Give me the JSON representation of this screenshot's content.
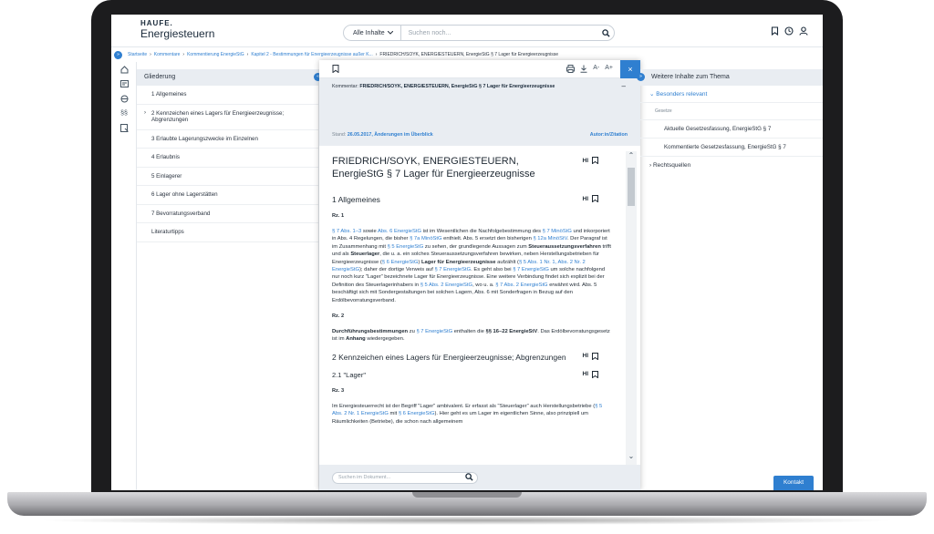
{
  "header": {
    "brand": "HAUFE.",
    "product": "Energiesteuern",
    "search_scope": "Alle Inhalte",
    "search_placeholder": "Suchen noch..."
  },
  "breadcrumb": [
    "Startseite",
    "Kommentare",
    "Kommentierung EnergieStG",
    "Kapitel 2 - Bestimmungen für Energieerzeugnisse außer K...",
    "FRIEDRICH/SOYK, ENERGIESTEUERN, EnergieStG § 7 Lager für Energieerzeugnisse"
  ],
  "outline": {
    "title": "Gliederung",
    "items": [
      "1 Allgemeines",
      "2 Kennzeichen eines Lagers für Energieerzeugnisse; Abgrenzungen",
      "3 Erlaubte Lagerungszwecke im Einzelnen",
      "4 Erlaubnis",
      "5 Einlagerer",
      "6 Lager ohne Lagerstätten",
      "7 Bevorratungsverband",
      "Literaturtipps"
    ]
  },
  "doc": {
    "toolbar": {
      "font_small": "A-",
      "font_large": "A+",
      "close": "×"
    },
    "meta_label": "Kommentar:",
    "meta_value": "FRIEDRICH/SOYK, ENERGIESTEUERN, EnergieStG § 7 Lager für Energieerzeugnisse",
    "meta_minus": "–",
    "stand_label": "Stand:",
    "stand_value": "26.05.2017, Änderungen im Überblick",
    "cite": "Autor:in/Zitation",
    "title": "FRIEDRICH/SOYK, ENERGIESTEUERN, EnergieStG § 7 Lager für Energieerzeugnisse",
    "hi": "HI",
    "sec1": "1 Allgemeines",
    "rz1": "Rz. 1",
    "rz2": "Rz. 2",
    "sec2": "2 Kennzeichen eines Lagers für Energieerzeugnisse; Abgrenzungen",
    "sec21": "2.1 \"Lager\"",
    "rz3": "Rz. 3",
    "search_placeholder": "Suchen im Dokument..."
  },
  "right": {
    "title": "Weitere Inhalte zum Thema",
    "sub": "Besonders relevant",
    "cat": "Gesetze",
    "items": [
      "Aktuelle Gesetzesfassung, EnergieStG § 7",
      "Kommentierte Gesetzesfassung, EnergieStG § 7"
    ],
    "sources": "Rechtsquellen"
  },
  "kontakt": "Kontakt",
  "colors": {
    "accent": "#2f7fd0",
    "panel_bg": "#e9edf2",
    "text": "#1f2933"
  }
}
